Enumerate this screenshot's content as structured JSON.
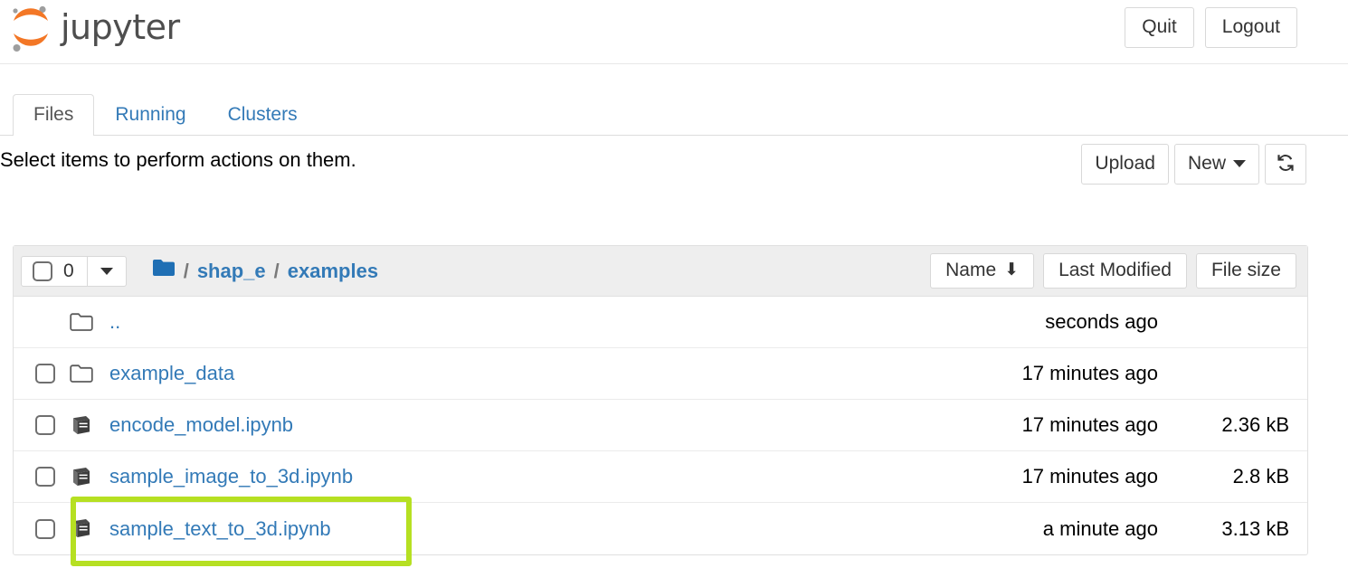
{
  "header": {
    "brand_text": "jupyter",
    "logo_icon": "jupyter-logo",
    "quit_label": "Quit",
    "logout_label": "Logout"
  },
  "tabs": [
    {
      "label": "Files",
      "active": true
    },
    {
      "label": "Running",
      "active": false
    },
    {
      "label": "Clusters",
      "active": false
    }
  ],
  "toolbar": {
    "note": "Select items to perform actions on them.",
    "upload_label": "Upload",
    "new_label": "New",
    "new_caret_icon": "caret-down-icon",
    "refresh_icon": "refresh-icon"
  },
  "filelist": {
    "selected_count": "0",
    "select_all_checkbox_icon": "checkbox-unchecked-icon",
    "select_caret_icon": "caret-down-icon",
    "breadcrumb": {
      "home_icon": "folder-icon",
      "separator": "/",
      "crumbs": [
        "shap_e",
        "examples"
      ]
    },
    "columns": {
      "name": "Name",
      "name_sort_icon": "arrow-down-icon",
      "last_modified": "Last Modified",
      "file_size": "File size"
    },
    "rows": [
      {
        "name": "..",
        "icon": "folder-icon",
        "type": "directory",
        "has_checkbox": false,
        "last_modified": "seconds ago",
        "size": ""
      },
      {
        "name": "example_data",
        "icon": "folder-icon",
        "type": "directory",
        "has_checkbox": true,
        "last_modified": "17 minutes ago",
        "size": ""
      },
      {
        "name": "encode_model.ipynb",
        "icon": "notebook-icon",
        "type": "notebook",
        "has_checkbox": true,
        "last_modified": "17 minutes ago",
        "size": "2.36 kB"
      },
      {
        "name": "sample_image_to_3d.ipynb",
        "icon": "notebook-icon",
        "type": "notebook",
        "has_checkbox": true,
        "last_modified": "17 minutes ago",
        "size": "2.8 kB"
      },
      {
        "name": "sample_text_to_3d.ipynb",
        "icon": "notebook-icon",
        "type": "notebook",
        "has_checkbox": true,
        "last_modified": "a minute ago",
        "size": "3.13 kB",
        "highlighted": true
      }
    ]
  },
  "colors": {
    "link_blue": "#337ab7",
    "logo_orange": "#f37726",
    "logo_gray": "#9e9e9e",
    "highlight_green": "#b6e022",
    "folder_blue": "#1f6fb4",
    "notebook_gray": "#4a4a4a"
  }
}
